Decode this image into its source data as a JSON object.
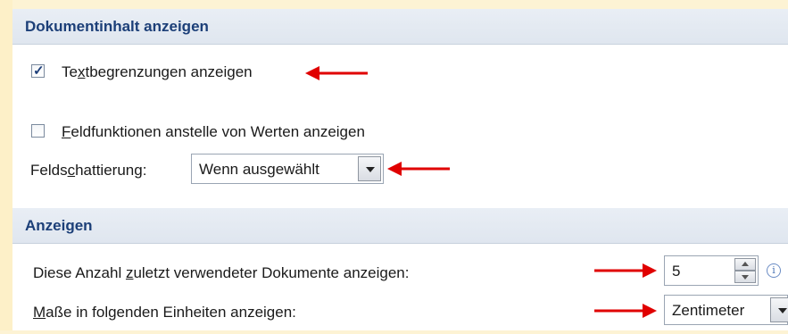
{
  "sections": {
    "document_content": {
      "title": "Dokumentinhalt anzeigen"
    },
    "display": {
      "title": "Anzeigen"
    }
  },
  "text_boundaries": {
    "label_pre": "Te",
    "label_accel": "x",
    "label_post": "tbegrenzungen anzeigen",
    "checked": true
  },
  "field_codes": {
    "label_accel": "F",
    "label_post": "eldfunktionen anstelle von Werten anzeigen",
    "checked": false
  },
  "field_shading": {
    "label_pre": "Felds",
    "label_accel": "c",
    "label_post": "hattierung:",
    "value": "Wenn ausgewählt"
  },
  "recent_documents": {
    "label_pre": "Diese Anzahl ",
    "label_accel": "z",
    "label_post": "uletzt verwendeter Dokumente anzeigen:",
    "value": "5"
  },
  "units": {
    "label_accel": "M",
    "label_post": "aße in folgenden Einheiten anzeigen:",
    "value": "Zentimeter"
  },
  "colors": {
    "header_text": "#1c3f78",
    "annotation_arrow": "#e00000"
  },
  "icons": {
    "info": "i"
  }
}
